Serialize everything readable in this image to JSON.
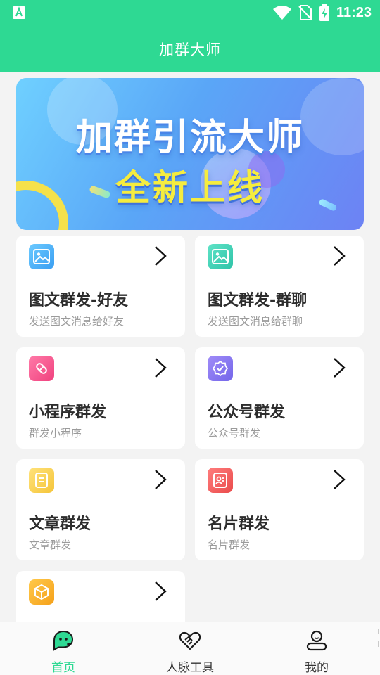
{
  "status_bar": {
    "time": "11:23"
  },
  "app_bar": {
    "title": "加群大师"
  },
  "banner": {
    "line1": "加群引流大师",
    "line2": "全新上线"
  },
  "features": [
    {
      "title": "图文群发-好友",
      "subtitle": "发送图文消息给好友",
      "icon": "image-icon",
      "color": "#4fb2f6"
    },
    {
      "title": "图文群发-群聊",
      "subtitle": "发送图文消息给群聊",
      "icon": "image-icon",
      "color": "#3ed1b6"
    },
    {
      "title": "小程序群发",
      "subtitle": "群发小程序",
      "icon": "mini-program-icon",
      "color": "#f5568f"
    },
    {
      "title": "公众号群发",
      "subtitle": "公众号群发",
      "icon": "verified-badge-icon",
      "color": "#8a7cf0"
    },
    {
      "title": "文章群发",
      "subtitle": "文章群发",
      "icon": "article-icon",
      "color": "#f7cf48"
    },
    {
      "title": "名片群发",
      "subtitle": "名片群发",
      "icon": "contact-card-icon",
      "color": "#f05e5e"
    },
    {
      "title": "",
      "subtitle": "",
      "icon": "package-icon",
      "color": "#f7b328"
    }
  ],
  "tab_bar": {
    "home": "首页",
    "contacts_tools": "人脉工具",
    "mine": "我的",
    "active_color": "#2ed993"
  }
}
